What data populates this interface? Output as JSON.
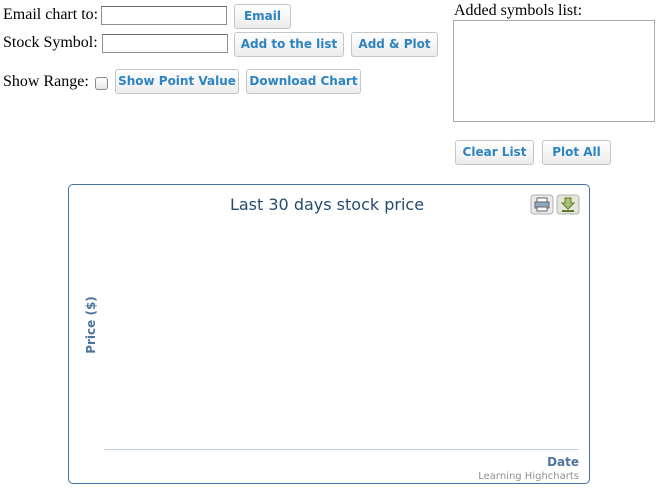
{
  "form": {
    "email_label": "Email chart to:",
    "email_value": "",
    "email_button": "Email",
    "symbol_label": "Stock Symbol:",
    "symbol_value": "",
    "add_to_list_button": "Add to the list",
    "add_plot_button": "Add & Plot",
    "show_range_label": "Show Range:",
    "show_range_checked": false,
    "show_point_value_button": "Show Point Value",
    "download_chart_button": "Download Chart"
  },
  "symbols_panel": {
    "title": "Added symbols list:",
    "items": [],
    "clear_button": "Clear List",
    "plot_all_button": "Plot All"
  },
  "colors": {
    "button_text": "#2e84c1",
    "chart_border": "#4572a7",
    "chart_title": "#274b6d",
    "axis_title": "#4d759e",
    "axis_line": "#c0d0e0",
    "credits": "#909090"
  },
  "chart_data": {
    "type": "line",
    "title": "Last 30 days stock price",
    "xlabel": "Date",
    "ylabel": "Price ($)",
    "series": [],
    "credits": "Learning Highcharts",
    "toolbar": [
      "print-icon",
      "export-icon"
    ]
  }
}
